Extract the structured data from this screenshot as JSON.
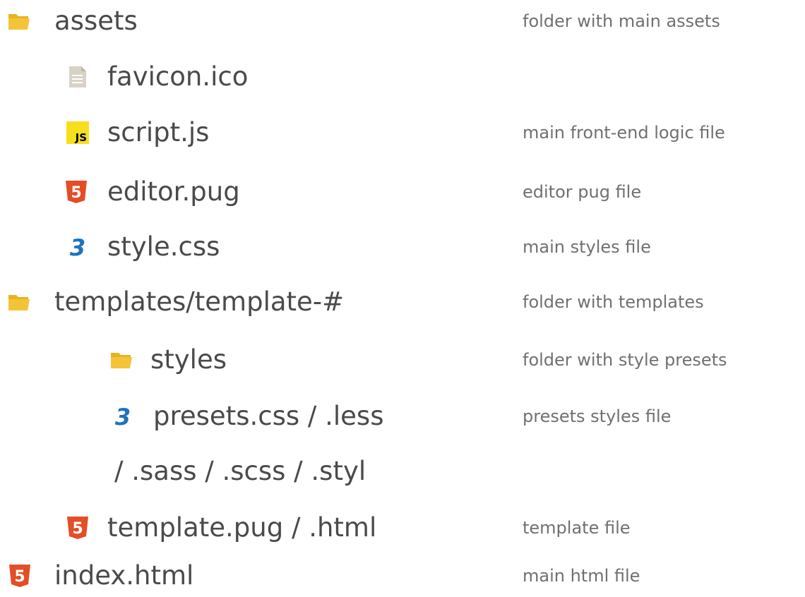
{
  "tree": [
    {
      "name": "assets",
      "desc": "folder with main assets",
      "icon": "folder-icon"
    },
    {
      "name": "favicon.ico",
      "desc": "",
      "icon": "file-icon"
    },
    {
      "name": "script.js",
      "desc": "main front-end logic file",
      "icon": "js-icon",
      "icon_text": "JS"
    },
    {
      "name": "editor.pug",
      "desc": "editor pug file",
      "icon": "html5-icon",
      "icon_text": "5"
    },
    {
      "name": "style.css",
      "desc": "main styles file",
      "icon": "css3-icon",
      "icon_text": "3"
    },
    {
      "name": "templates/template-#",
      "desc": "folder with templates",
      "icon": "folder-icon"
    },
    {
      "name": "styles",
      "desc": "folder with style presets",
      "icon": "folder-icon"
    },
    {
      "name": "presets.css / .less",
      "desc": "presets styles file",
      "icon": "css3-icon",
      "icon_text": "3"
    },
    {
      "name": "/ .sass / .scss / .styl",
      "desc": "",
      "icon": ""
    },
    {
      "name": "template.pug / .html",
      "desc": "template file",
      "icon": "html5-icon",
      "icon_text": "5"
    },
    {
      "name": "index.html",
      "desc": "main html file",
      "icon": "html5-icon",
      "icon_text": "5"
    }
  ],
  "colors": {
    "folder": "#f3c437",
    "js": "#f7df1e",
    "html5": "#e44d26",
    "css3": "#1e72be",
    "file": "#d8d3c6"
  }
}
